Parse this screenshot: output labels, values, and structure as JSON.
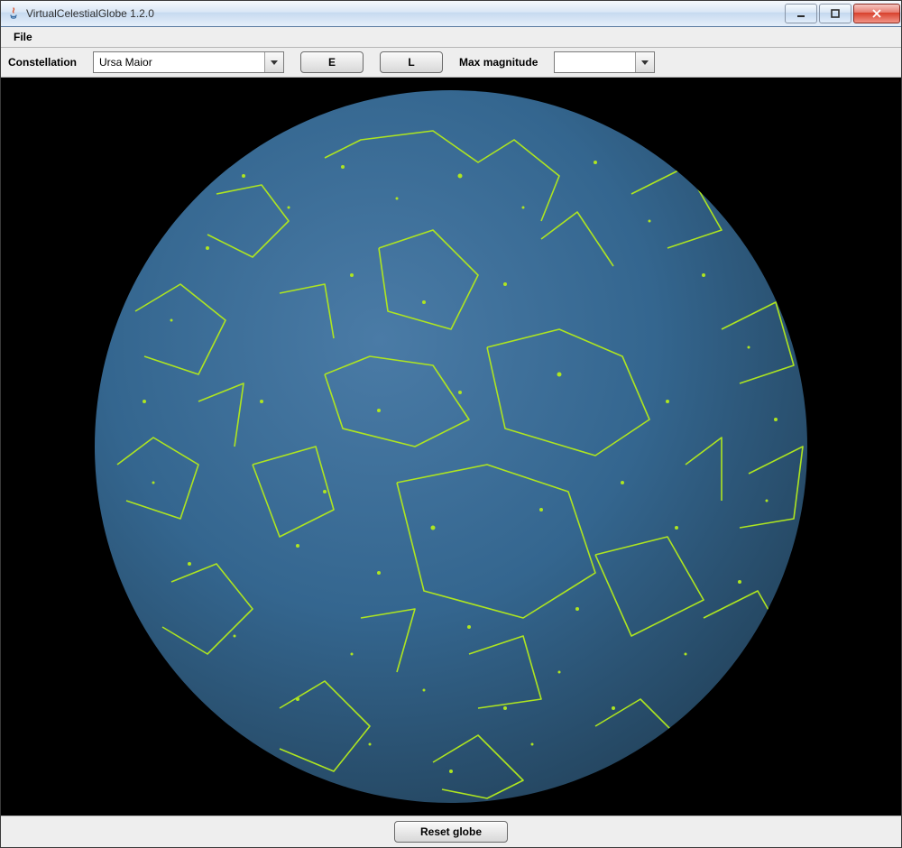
{
  "window": {
    "title": "VirtualCelestialGlobe 1.2.0",
    "menu": {
      "file": "File"
    }
  },
  "toolbar": {
    "constellation_label": "Constellation",
    "constellation_value": "Ursa Maior",
    "button_e": "E",
    "button_l": "L",
    "max_magnitude_label": "Max magnitude",
    "max_magnitude_value": ""
  },
  "footer": {
    "reset_button": "Reset globe"
  },
  "colors": {
    "globe_fill": "#34668f",
    "globe_shade": "#2a506f",
    "constellation_line": "#aee520",
    "canvas_bg": "#000000"
  }
}
